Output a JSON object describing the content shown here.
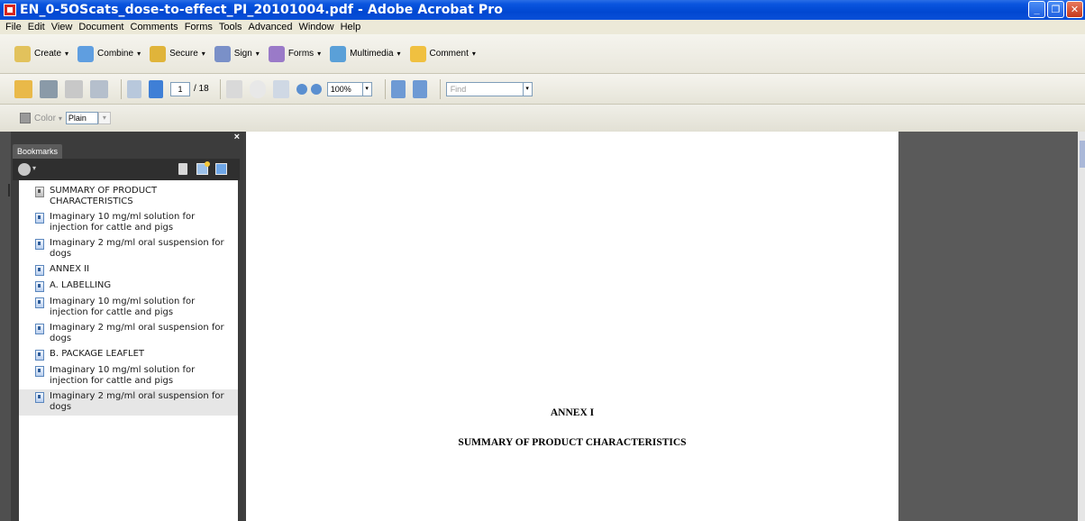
{
  "window": {
    "title": "EN_0-5OScats_dose-to-effect_PI_20101004.pdf - Adobe Acrobat Pro",
    "controls": [
      "minimize",
      "maximize",
      "close"
    ]
  },
  "menubar": {
    "items": [
      "File",
      "Edit",
      "View",
      "Document",
      "Comments",
      "Forms",
      "Tools",
      "Advanced",
      "Window",
      "Help"
    ]
  },
  "tasks": {
    "items": [
      {
        "label": "Create",
        "icon": "create-icon",
        "color": "#e2c25c"
      },
      {
        "label": "Combine",
        "icon": "combine-icon",
        "color": "#5f9ee0"
      },
      {
        "label": "Secure",
        "icon": "lock-icon",
        "color": "#e0b43a"
      },
      {
        "label": "Sign",
        "icon": "pen-icon",
        "color": "#7a90c8"
      },
      {
        "label": "Forms",
        "icon": "forms-icon",
        "color": "#9a7ac8"
      },
      {
        "label": "Multimedia",
        "icon": "multimedia-icon",
        "color": "#5aa0d8"
      },
      {
        "label": "Comment",
        "icon": "comment-icon",
        "color": "#f0c040"
      }
    ]
  },
  "navigation": {
    "page_current": "1",
    "page_total": "/ 18",
    "zoom": "100%",
    "find_placeholder": "Find"
  },
  "properties": {
    "color_label": "Color",
    "font_style": "Plain"
  },
  "bookmarks": {
    "tab_label": "Bookmarks",
    "close_glyph": "×",
    "items": [
      {
        "label": "SUMMARY OF PRODUCT CHARACTERISTICS",
        "icon": "gray"
      },
      {
        "label": "Imaginary 10 mg/ml solution for injection for cattle and pigs",
        "icon": "blue"
      },
      {
        "label": "Imaginary 2 mg/ml oral suspension for dogs",
        "icon": "blue"
      },
      {
        "label": "ANNEX II",
        "icon": "blue"
      },
      {
        "label": "A. LABELLING",
        "icon": "blue"
      },
      {
        "label": "Imaginary 10 mg/ml solution for injection for cattle and pigs",
        "icon": "blue"
      },
      {
        "label": "Imaginary 2 mg/ml oral suspension for dogs",
        "icon": "blue"
      },
      {
        "label": "B. PACKAGE LEAFLET",
        "icon": "blue"
      },
      {
        "label": "Imaginary 10 mg/ml solution for injection for cattle and pigs",
        "icon": "blue"
      },
      {
        "label": "Imaginary 2 mg/ml oral suspension for dogs",
        "icon": "blue",
        "selected": true
      }
    ]
  },
  "document": {
    "heading": "ANNEX I",
    "subheading": "SUMMARY OF PRODUCT CHARACTERISTICS"
  },
  "colors": {
    "titlebar": "#0047d1",
    "chrome": "#ece9d8",
    "panel_dark": "#3c3c3c",
    "workspace_gray": "#5a5a5a"
  }
}
